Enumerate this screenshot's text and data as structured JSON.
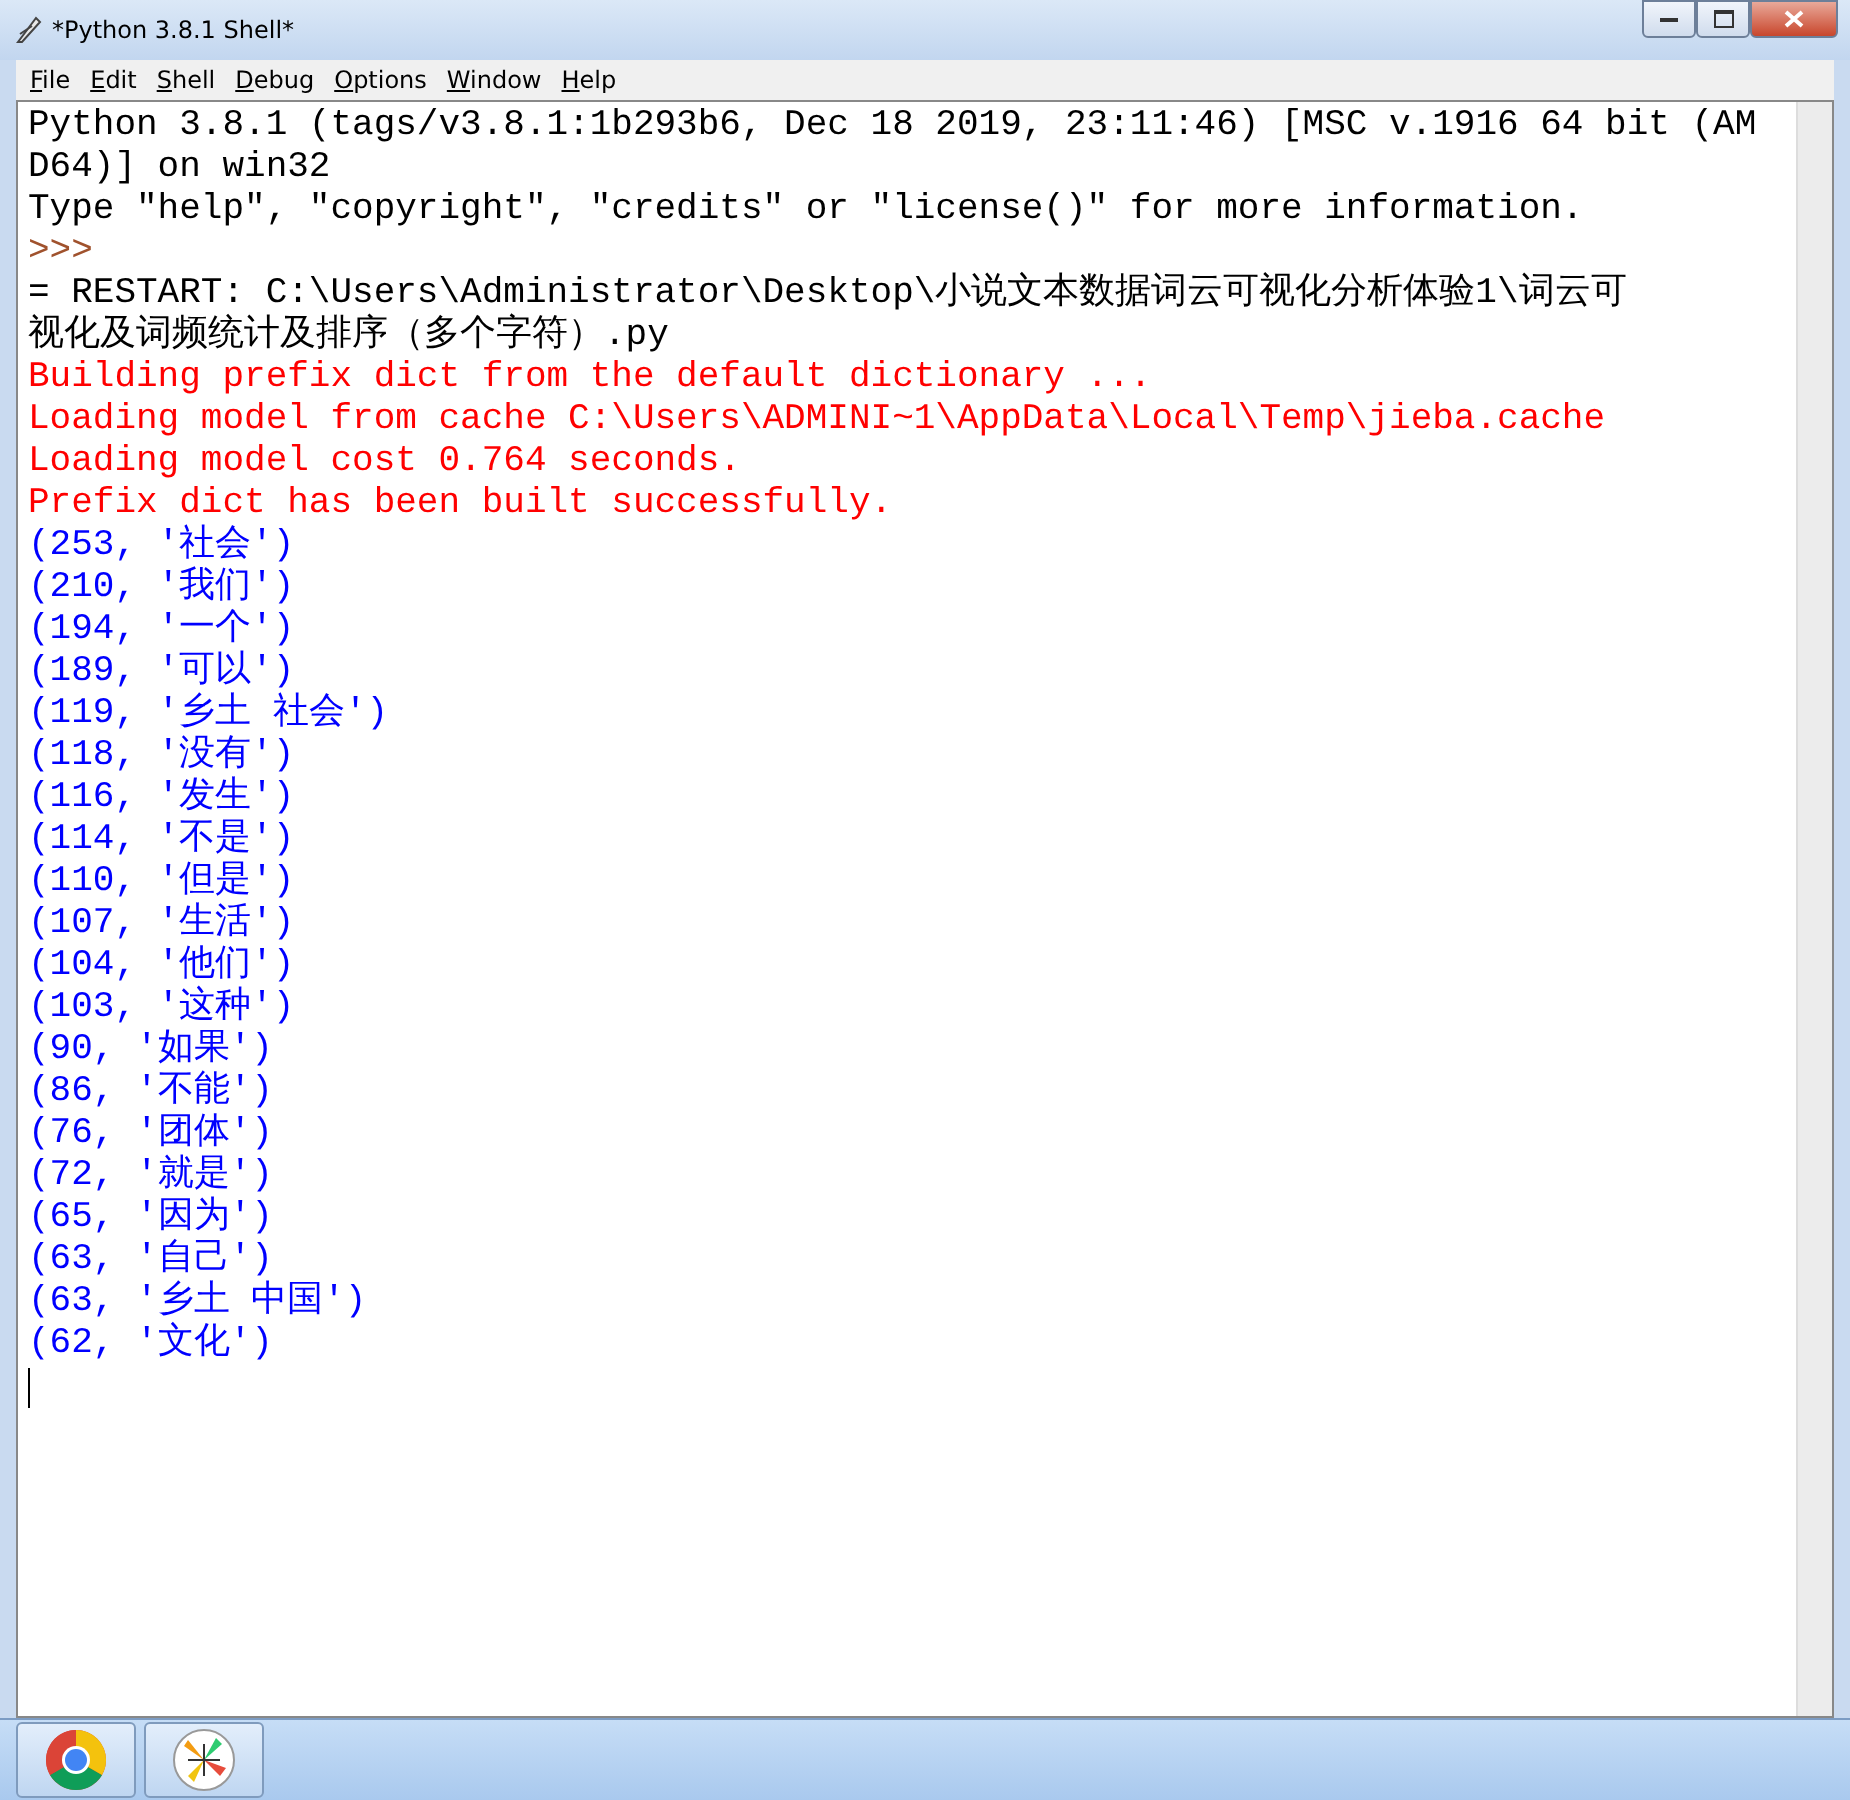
{
  "window": {
    "title": "*Python 3.8.1 Shell*"
  },
  "menu": [
    "File",
    "Edit",
    "Shell",
    "Debug",
    "Options",
    "Window",
    "Help"
  ],
  "console_lines": [
    {
      "kind": "output",
      "text": "Python 3.8.1 (tags/v3.8.1:1b293b6, Dec 18 2019, 23:11:46) [MSC v.1916 64 bit (AM"
    },
    {
      "kind": "output",
      "text": "D64)] on win32"
    },
    {
      "kind": "output",
      "text": "Type \"help\", \"copyright\", \"credits\" or \"license()\" for more information."
    },
    {
      "kind": "prompt",
      "text": ">>>"
    },
    {
      "kind": "output",
      "text": "= RESTART: C:\\Users\\Administrator\\Desktop\\小说文本数据词云可视化分析体验1\\词云可"
    },
    {
      "kind": "output",
      "text": "视化及词频统计及排序（多个字符）.py"
    },
    {
      "kind": "stderr",
      "text": "Building prefix dict from the default dictionary ..."
    },
    {
      "kind": "stderr",
      "text": "Loading model from cache C:\\Users\\ADMINI~1\\AppData\\Local\\Temp\\jieba.cache"
    },
    {
      "kind": "stderr",
      "text": "Loading model cost 0.764 seconds."
    },
    {
      "kind": "stderr",
      "text": "Prefix dict has been built successfully."
    },
    {
      "kind": "stdout",
      "text": "(253, '社会')"
    },
    {
      "kind": "stdout",
      "text": "(210, '我们')"
    },
    {
      "kind": "stdout",
      "text": "(194, '一个')"
    },
    {
      "kind": "stdout",
      "text": "(189, '可以')"
    },
    {
      "kind": "stdout",
      "text": "(119, '乡土 社会')"
    },
    {
      "kind": "stdout",
      "text": "(118, '没有')"
    },
    {
      "kind": "stdout",
      "text": "(116, '发生')"
    },
    {
      "kind": "stdout",
      "text": "(114, '不是')"
    },
    {
      "kind": "stdout",
      "text": "(110, '但是')"
    },
    {
      "kind": "stdout",
      "text": "(107, '生活')"
    },
    {
      "kind": "stdout",
      "text": "(104, '他们')"
    },
    {
      "kind": "stdout",
      "text": "(103, '这种')"
    },
    {
      "kind": "stdout",
      "text": "(90, '如果')"
    },
    {
      "kind": "stdout",
      "text": "(86, '不能')"
    },
    {
      "kind": "stdout",
      "text": "(76, '团体')"
    },
    {
      "kind": "stdout",
      "text": "(72, '就是')"
    },
    {
      "kind": "stdout",
      "text": "(65, '因为')"
    },
    {
      "kind": "stdout",
      "text": "(63, '自己')"
    },
    {
      "kind": "stdout",
      "text": "(63, '乡土 中国')"
    },
    {
      "kind": "stdout",
      "text": "(62, '文化')"
    }
  ]
}
